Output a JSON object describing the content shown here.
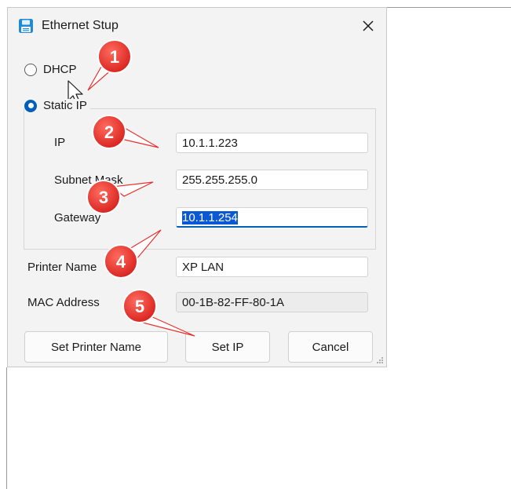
{
  "window": {
    "title": "Ethernet Stup",
    "icon": "save-icon",
    "close_icon": "close-icon"
  },
  "mode": {
    "dhcp_label": "DHCP",
    "static_label": "Static IP",
    "selected": "static"
  },
  "network": {
    "ip_label": "IP",
    "ip_value": "10.1.1.223",
    "subnet_label": "Subnet Mask",
    "subnet_value": "255.255.255.0",
    "gateway_label": "Gateway",
    "gateway_value": "10.1.1.254"
  },
  "printer": {
    "name_label": "Printer Name",
    "name_value": "XP LAN",
    "mac_label": "MAC Address",
    "mac_value": "00-1B-82-FF-80-1A"
  },
  "buttons": {
    "set_name": "Set Printer Name",
    "set_ip": "Set IP",
    "cancel": "Cancel"
  },
  "annotations": [
    "1",
    "2",
    "3",
    "4",
    "5"
  ],
  "colors": {
    "accent": "#005fb8",
    "callout": "#e8302e",
    "selection": "#0a58d4"
  }
}
